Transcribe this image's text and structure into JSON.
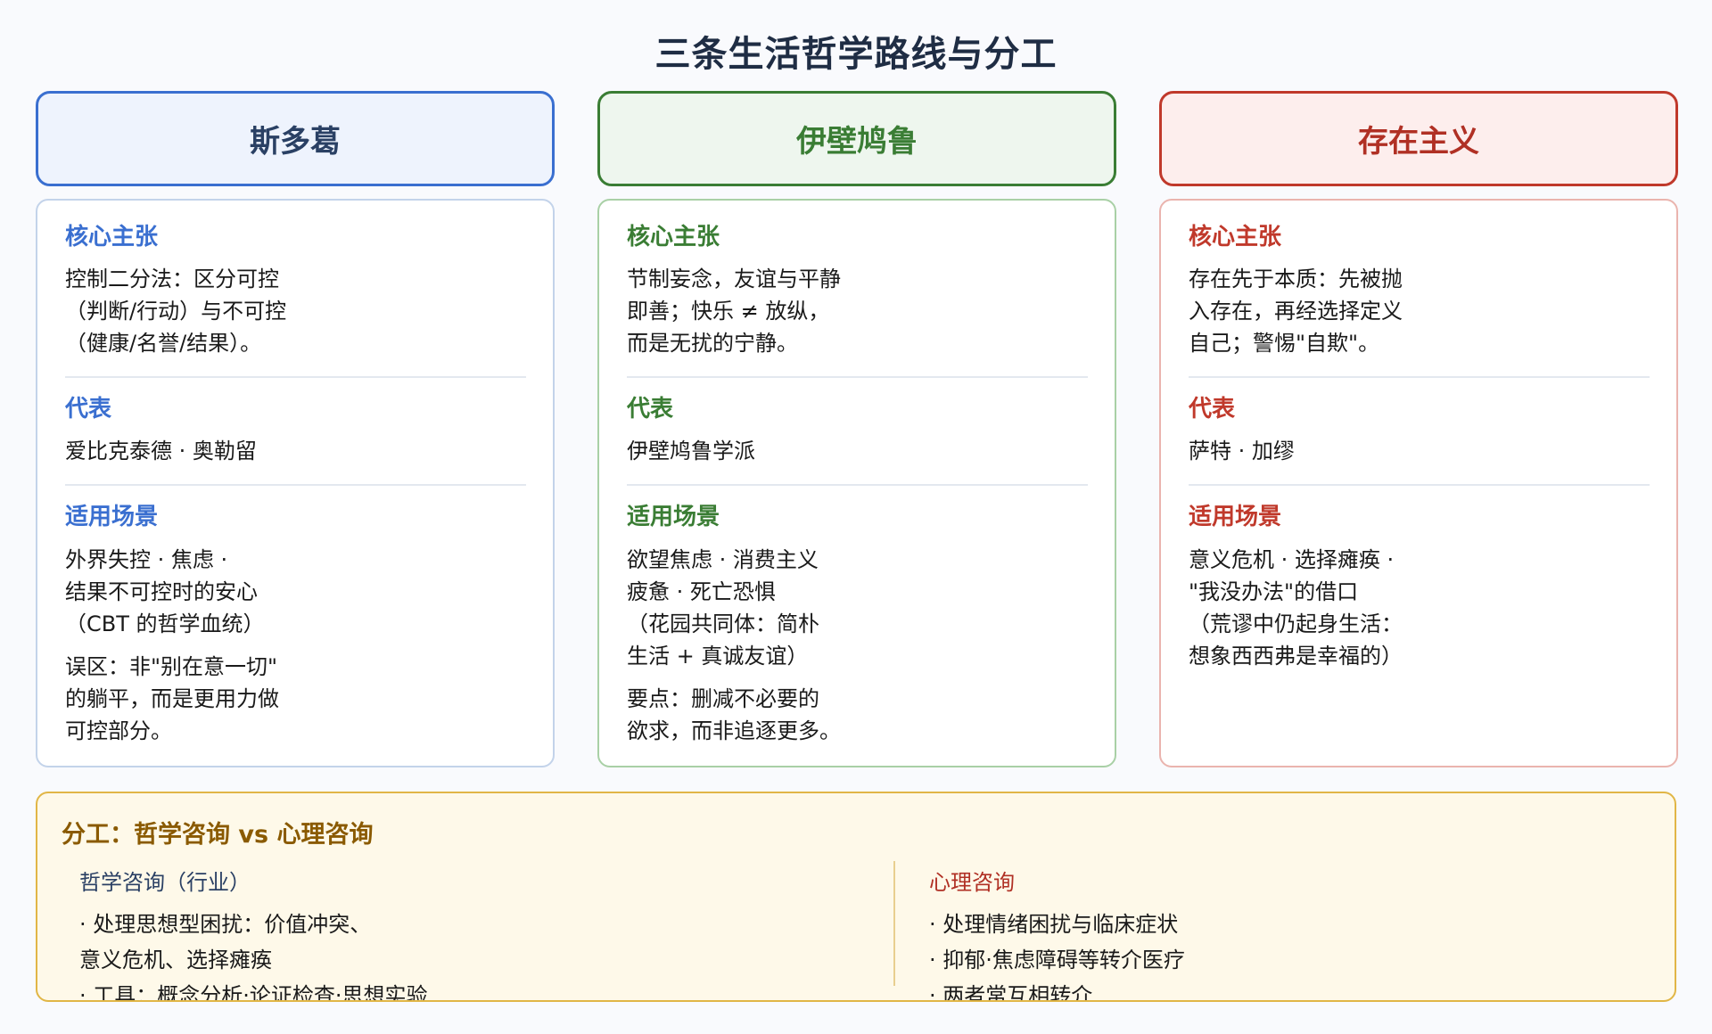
{
  "title": "三条生活哲学路线与分工",
  "colors": {
    "stoic": "#3a6fd0",
    "epicurean": "#3a7d34",
    "existential": "#c0392b",
    "division_accent": "#8a5a00"
  },
  "columns": [
    {
      "name": "斯多葛",
      "header_color": "#2a4064",
      "core_label": "核心主张",
      "core_text": "控制二分法：区分可控\n（判断/行动）与不可控\n（健康/名誉/结果）。",
      "rep_label": "代表",
      "rep_text": "爱比克泰德 · 奥勒留",
      "scene_label": "适用场景",
      "scene_text": "外界失控 · 焦虑 ·\n结果不可控时的安心\n（CBT 的哲学血统）",
      "note_text": "误区：非\"别在意一切\"\n的躺平，而是更用力做\n可控部分。"
    },
    {
      "name": "伊壁鸠鲁",
      "header_color": "#3a7d34",
      "core_label": "核心主张",
      "core_text": "节制妄念，友谊与平静\n即善；快乐 ≠ 放纵，\n而是无扰的宁静。",
      "rep_label": "代表",
      "rep_text": "伊壁鸠鲁学派",
      "scene_label": "适用场景",
      "scene_text": "欲望焦虑 · 消费主义\n疲惫 · 死亡恐惧\n（花园共同体：简朴\n生活 + 真诚友谊）",
      "note_text": "要点：删减不必要的\n欲求，而非追逐更多。"
    },
    {
      "name": "存在主义",
      "header_color": "#b03024",
      "core_label": "核心主张",
      "core_text": "存在先于本质：先被抛\n入存在，再经选择定义\n自己；警惕\"自欺\"。",
      "rep_label": "代表",
      "rep_text": "萨特 · 加缪",
      "scene_label": "适用场景",
      "scene_text": "意义危机 · 选择瘫痪 ·\n\"我没办法\"的借口\n（荒谬中仍起身生活：\n想象西西弗是幸福的）",
      "note_text": ""
    }
  ],
  "division": {
    "title": "分工：哲学咨询 vs 心理咨询",
    "left": {
      "label": "哲学咨询（行业）",
      "items": "· 处理思想型困扰：价值冲突、\n意义危机、选择瘫痪\n· 工具：概念分析·论证检查·思想实验"
    },
    "right": {
      "label": "心理咨询",
      "items": "· 处理情绪困扰与临床症状\n· 抑郁·焦虑障碍等转介医疗\n· 两者常互相转介"
    }
  }
}
